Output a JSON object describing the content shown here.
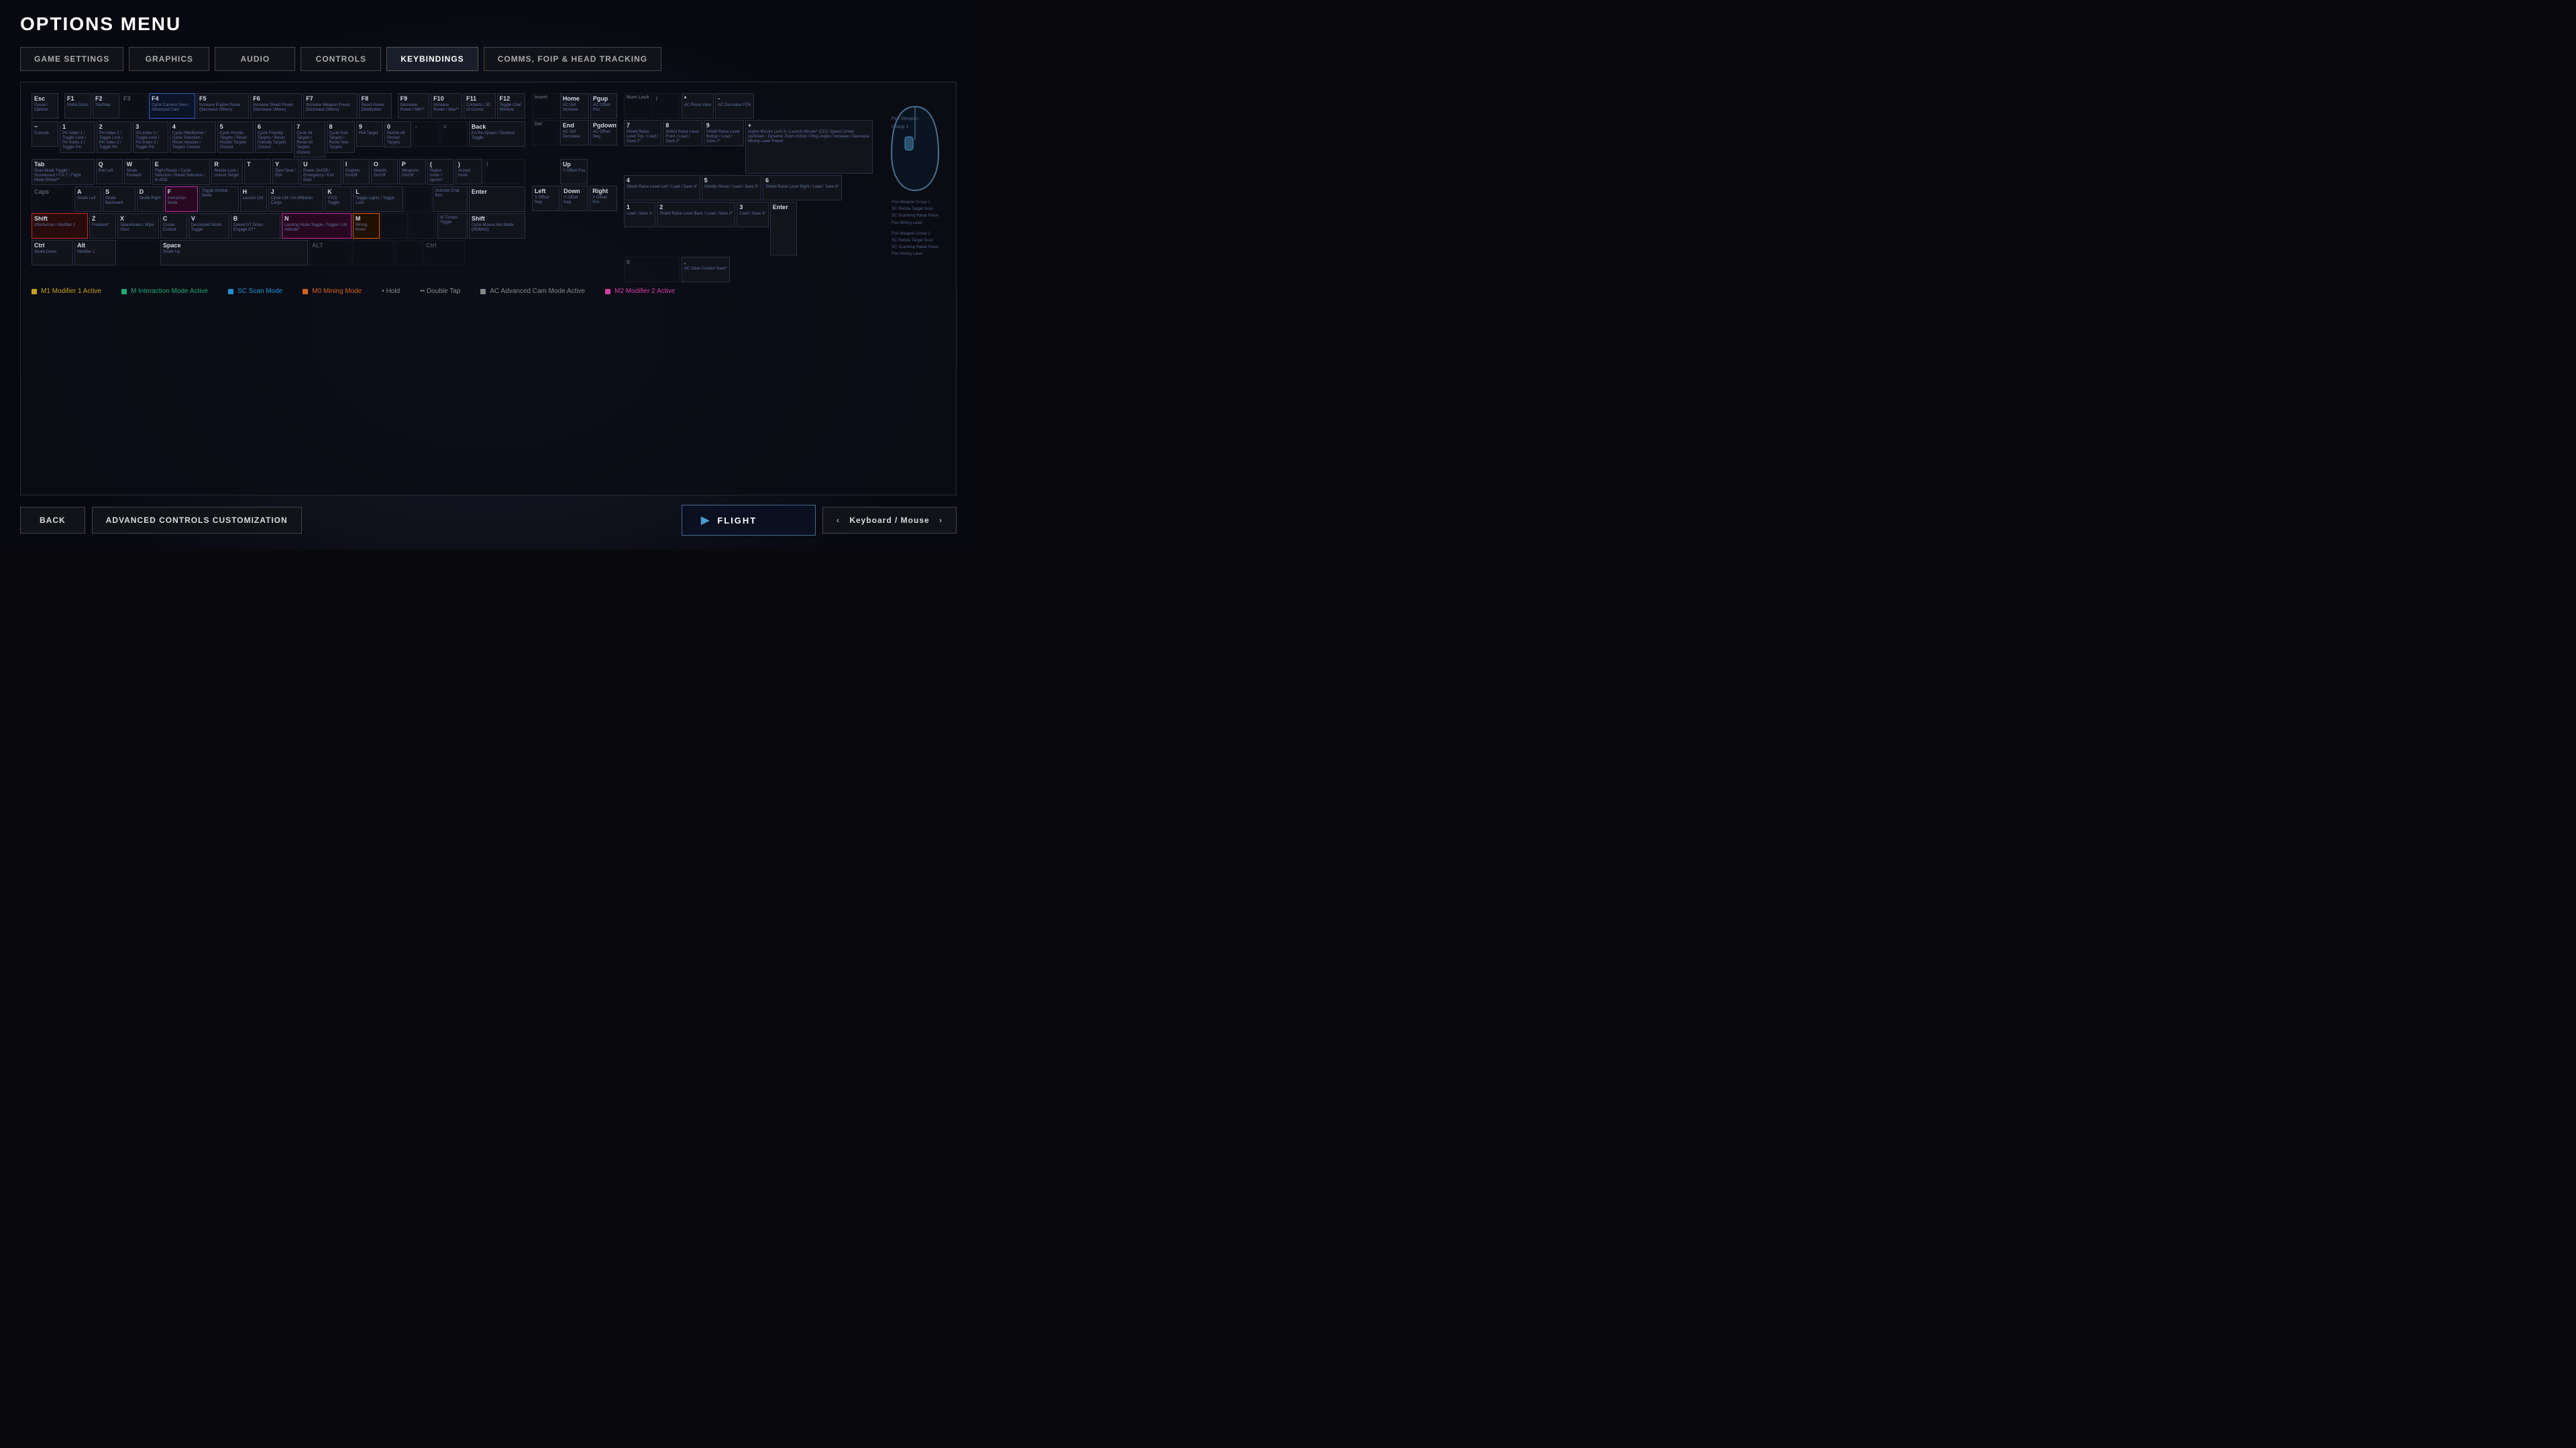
{
  "page": {
    "title": "OPTIONS MENU",
    "tabs": [
      {
        "id": "game-settings",
        "label": "GAME SETTINGS",
        "active": false
      },
      {
        "id": "graphics",
        "label": "GRAPHICS",
        "active": false
      },
      {
        "id": "audio",
        "label": "AUDIO",
        "active": false
      },
      {
        "id": "controls",
        "label": "CONTROLS",
        "active": false
      },
      {
        "id": "keybindings",
        "label": "KEYBINDINGS",
        "active": true
      },
      {
        "id": "comms",
        "label": "COMMS, FOIP & HEAD TRACKING",
        "active": false
      }
    ]
  },
  "bottom": {
    "back_label": "BACK",
    "advanced_label": "ADVANCED CONTROLS CUSTOMIZATION",
    "flight_label": "FLIGHT",
    "keyboard_mouse_label": "Keyboard / Mouse"
  },
  "legend": {
    "m1_label": "M1  Modifier 1 Active",
    "m_label": "M   Interaction Mode Active",
    "sc_label": "SC  Scan Mode",
    "m0_label": "M0  Mining Mode",
    "ac_label": "AC  Advanced Cam Mode Active",
    "hold_label": "Hold",
    "double_tap_label": "Double Tap",
    "m2_label": "M2  Modifier 2 Active"
  },
  "colors": {
    "m1": "#c8a020",
    "m_interact": "#20a870",
    "sc": "#2090d0",
    "m0": "#d06020",
    "ac": "#606060",
    "m2": "#d040a0"
  }
}
